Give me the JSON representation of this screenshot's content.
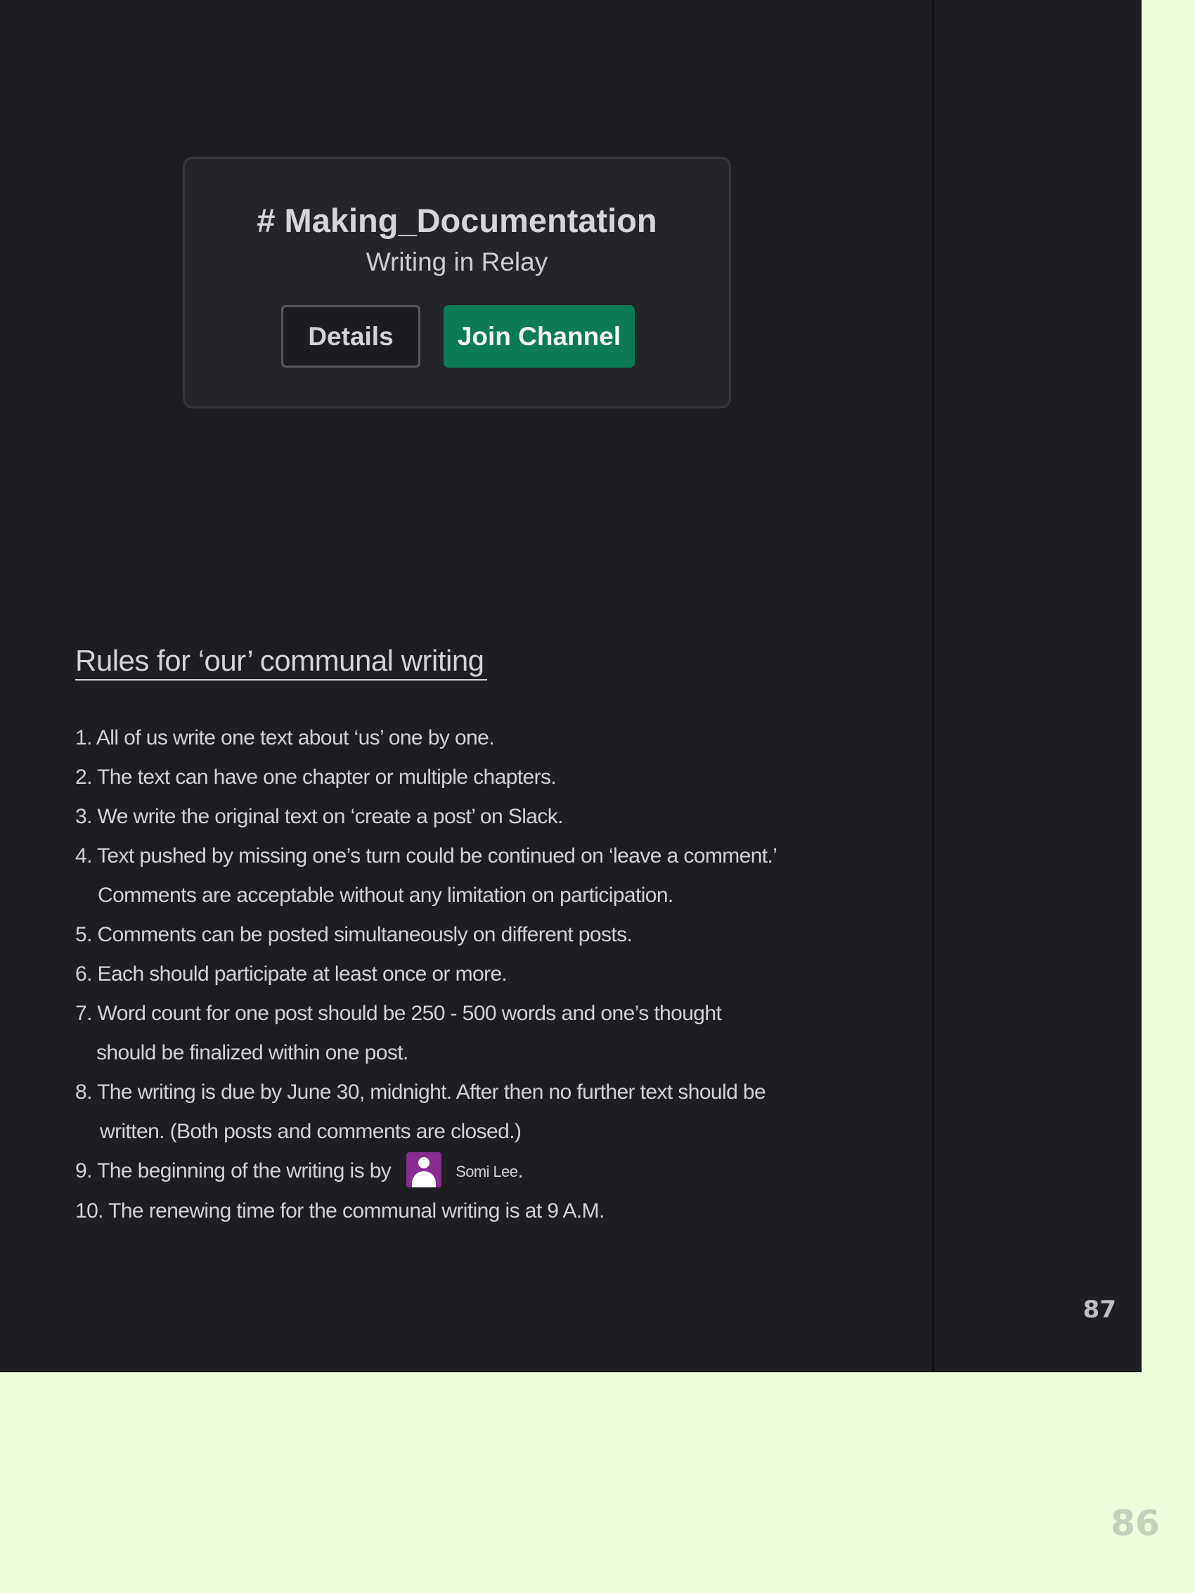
{
  "channel_card": {
    "title": "# Making_Documentation",
    "subtitle": "Writing in Relay",
    "details_label": "Details",
    "join_label": "Join Channel"
  },
  "rules": {
    "heading": "Rules for ‘our’ communal writing",
    "items": [
      "1. All of us write one text about ‘us’ one by one.",
      "2. The text can have one chapter or multiple chapters.",
      "3. We write the original text on ‘create a post’ on Slack.",
      "4. Text pushed by missing one’s turn could be continued on ‘leave a comment.’",
      "Comments are acceptable without any limitation on participation.",
      "5. Comments can be posted simultaneously on different posts.",
      "6. Each should participate at least once or more.",
      "7. Word count for one post should be 250 - 500 words and one’s thought",
      "should be finalized within one post.",
      "8. The writing is due by June 30, midnight. After then no further text should be",
      "written. (Both posts and comments are closed.)",
      "9. The beginning of the writing is by",
      "Somi Lee",
      ".",
      "10. The renewing time for the communal writing is at 9 A.M."
    ]
  },
  "page_numbers": {
    "front": "87",
    "back": "86"
  },
  "colors": {
    "page_background": "#eefcdc",
    "dark_page": "#1d1d22",
    "card_background": "#242529",
    "join_button": "#0b7a55",
    "avatar": "#8a2c92"
  },
  "icons": {
    "avatar": "user-avatar-icon"
  }
}
